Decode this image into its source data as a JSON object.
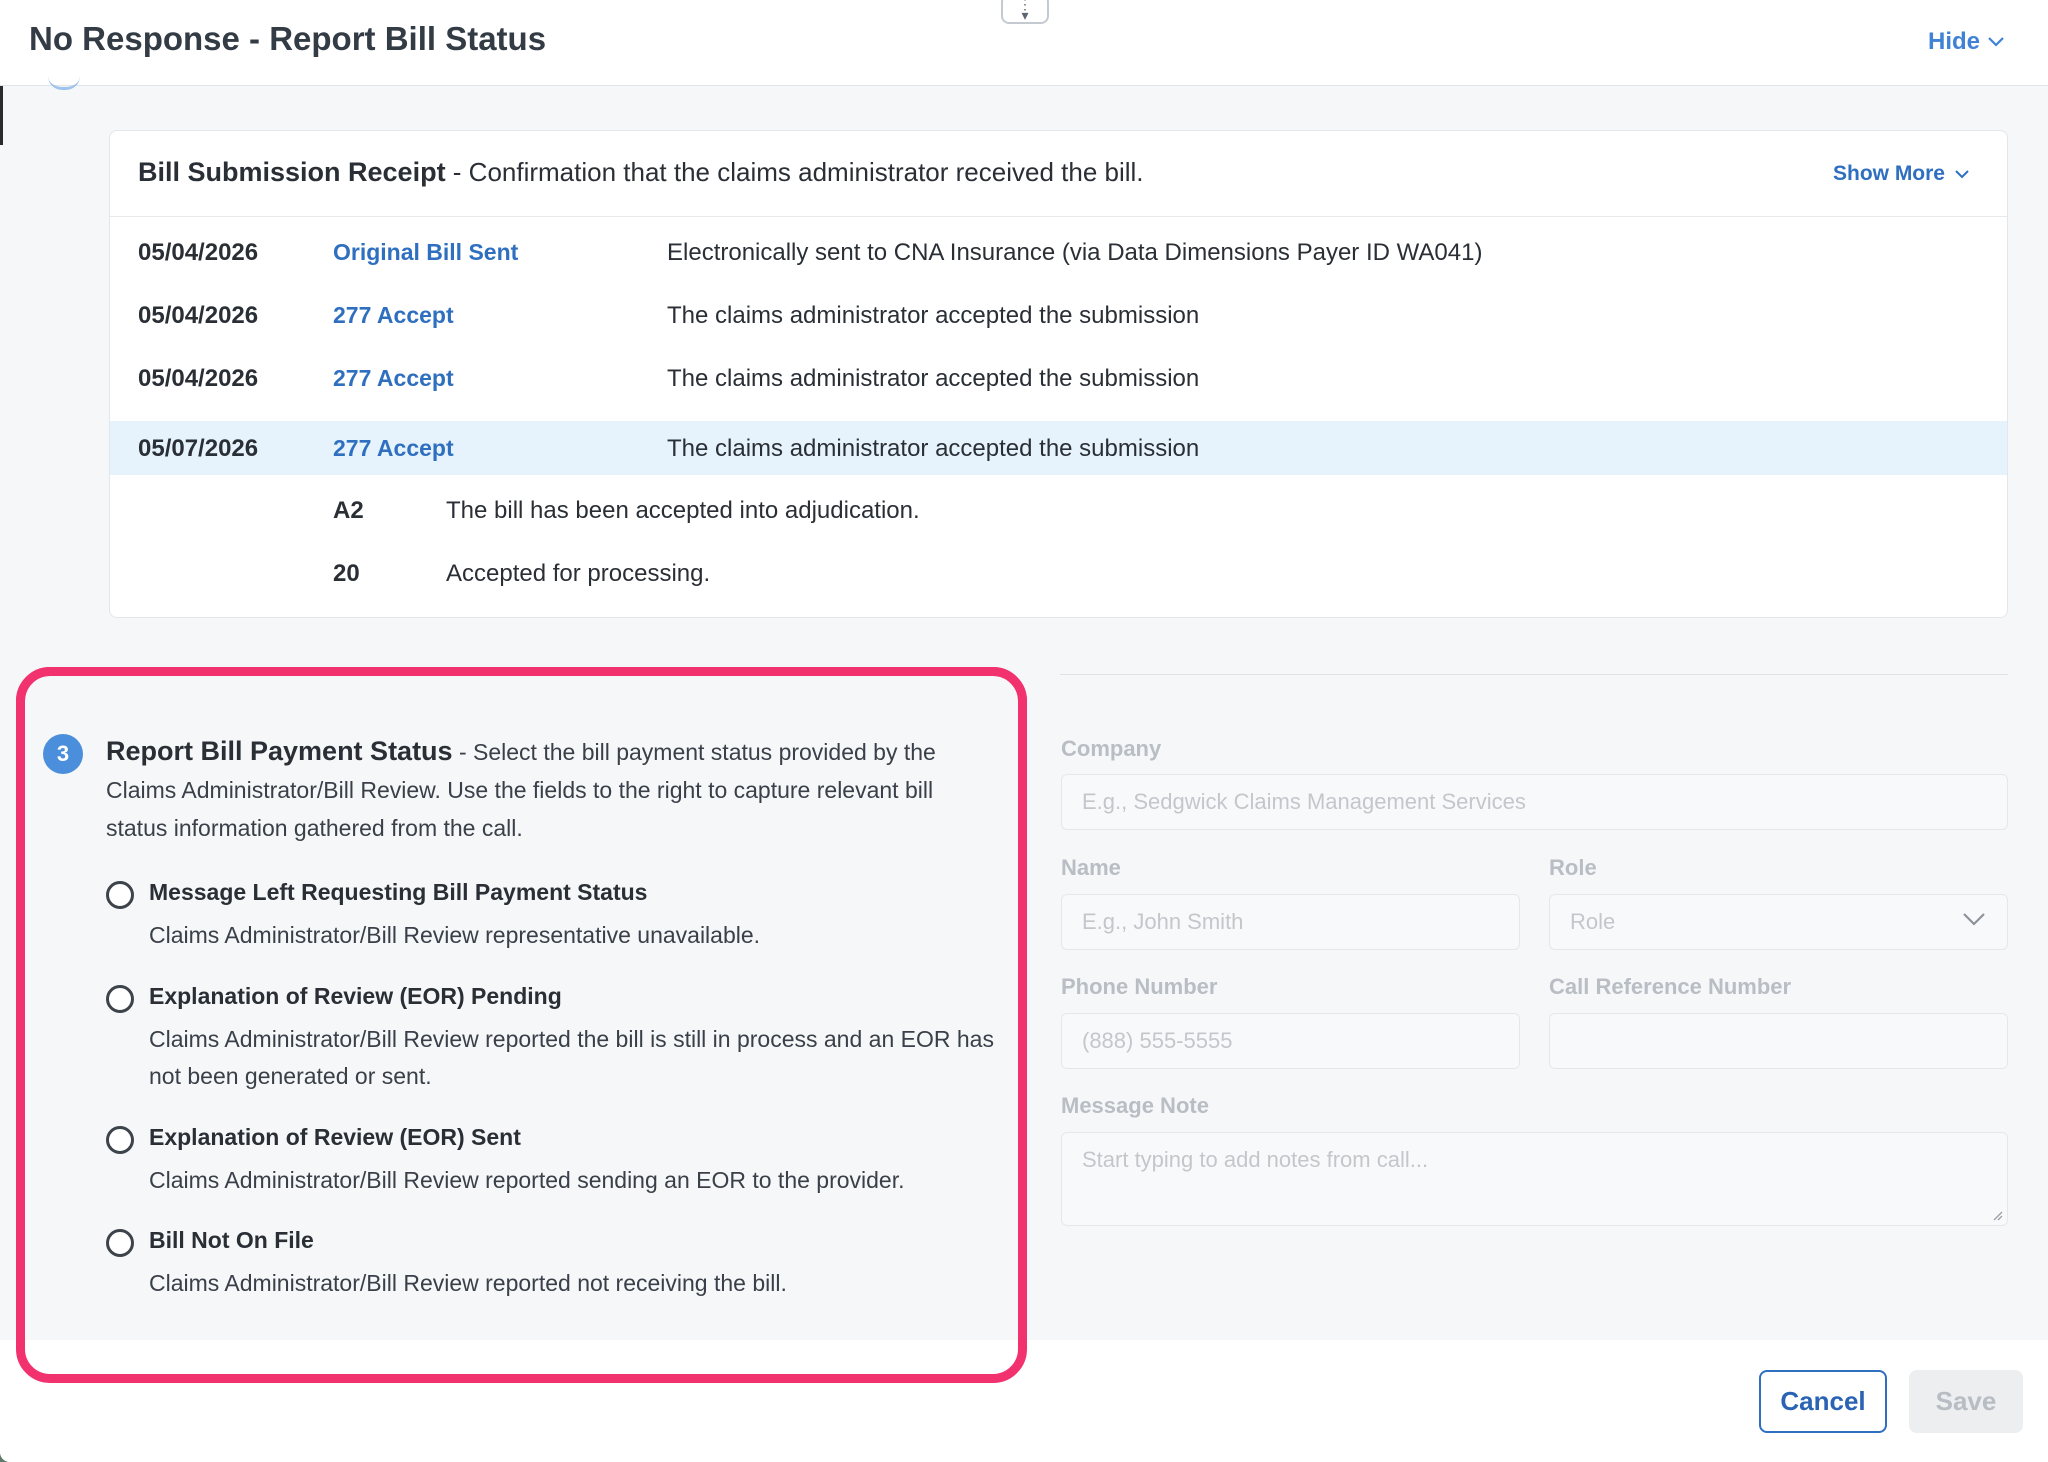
{
  "header": {
    "title": "No Response - Report Bill Status",
    "hide_label": "Hide"
  },
  "receipt": {
    "title": "Bill Submission Receipt",
    "subtitle": " - Confirmation that the claims administrator received the bill.",
    "show_more_label": "Show More",
    "rows": [
      {
        "date": "05/04/2026",
        "event": "Original Bill Sent",
        "description": "Electronically sent to CNA Insurance (via Data Dimensions Payer ID WA041)"
      },
      {
        "date": "05/04/2026",
        "event": "277 Accept",
        "description": "The claims administrator accepted the submission"
      },
      {
        "date": "05/04/2026",
        "event": "277 Accept",
        "description": "The claims administrator accepted the submission"
      },
      {
        "date": "05/07/2026",
        "event": "277 Accept",
        "description": "The claims administrator accepted the submission"
      }
    ],
    "codes": [
      {
        "code": "A2",
        "description": "The bill has been accepted into adjudication."
      },
      {
        "code": "20",
        "description": "Accepted for processing."
      }
    ]
  },
  "status_section": {
    "step_number": "3",
    "heading": "Report Bill Payment Status",
    "intro": " - Select the bill payment status provided by the Claims Administrator/Bill Review. Use the fields to the right to capture relevant bill status information gathered from the call.",
    "options": [
      {
        "label": "Message Left Requesting Bill Payment Status",
        "description": "Claims Administrator/Bill Review representative unavailable."
      },
      {
        "label": "Explanation of Review (EOR) Pending",
        "description": "Claims Administrator/Bill Review reported the bill is still in process and an EOR has not been generated or sent."
      },
      {
        "label": "Explanation of Review (EOR) Sent",
        "description": "Claims Administrator/Bill Review reported sending an EOR to the provider."
      },
      {
        "label": "Bill Not On File",
        "description": "Claims Administrator/Bill Review reported not receiving the bill."
      }
    ]
  },
  "form": {
    "company_label": "Company",
    "company_placeholder": "E.g., Sedgwick Claims Management Services",
    "name_label": "Name",
    "name_placeholder": "E.g., John Smith",
    "role_label": "Role",
    "role_value": "Role",
    "phone_label": "Phone Number",
    "phone_placeholder": "(888) 555-5555",
    "call_ref_label": "Call Reference Number",
    "call_ref_value": "",
    "note_label": "Message Note",
    "note_placeholder": "Start typing to add notes from call..."
  },
  "footer": {
    "cancel_label": "Cancel",
    "save_label": "Save"
  },
  "colors": {
    "accent": "#3f82d6",
    "highlight_border": "#f2326e",
    "row_highlight": "#e7f3fc"
  }
}
